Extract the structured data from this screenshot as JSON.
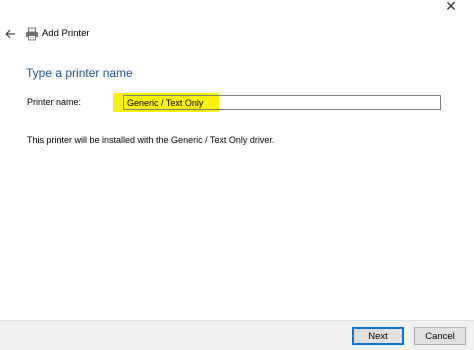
{
  "window": {
    "title": "Add Printer",
    "close_glyph": "✕"
  },
  "icons": {
    "back": "back-arrow-icon",
    "printer": "printer-icon"
  },
  "main": {
    "heading": "Type a printer name",
    "printer_name_label": "Printer name:",
    "printer_name_value": "Generic / Text Only",
    "info_text": "This printer will be installed with the Generic / Text Only driver."
  },
  "footer": {
    "next_label": "Next",
    "cancel_label": "Cancel"
  },
  "colors": {
    "heading": "#1d4f91",
    "highlight": "#f8f400",
    "default_button_border": "#0078d7",
    "footer_background": "#f0f0f0"
  }
}
